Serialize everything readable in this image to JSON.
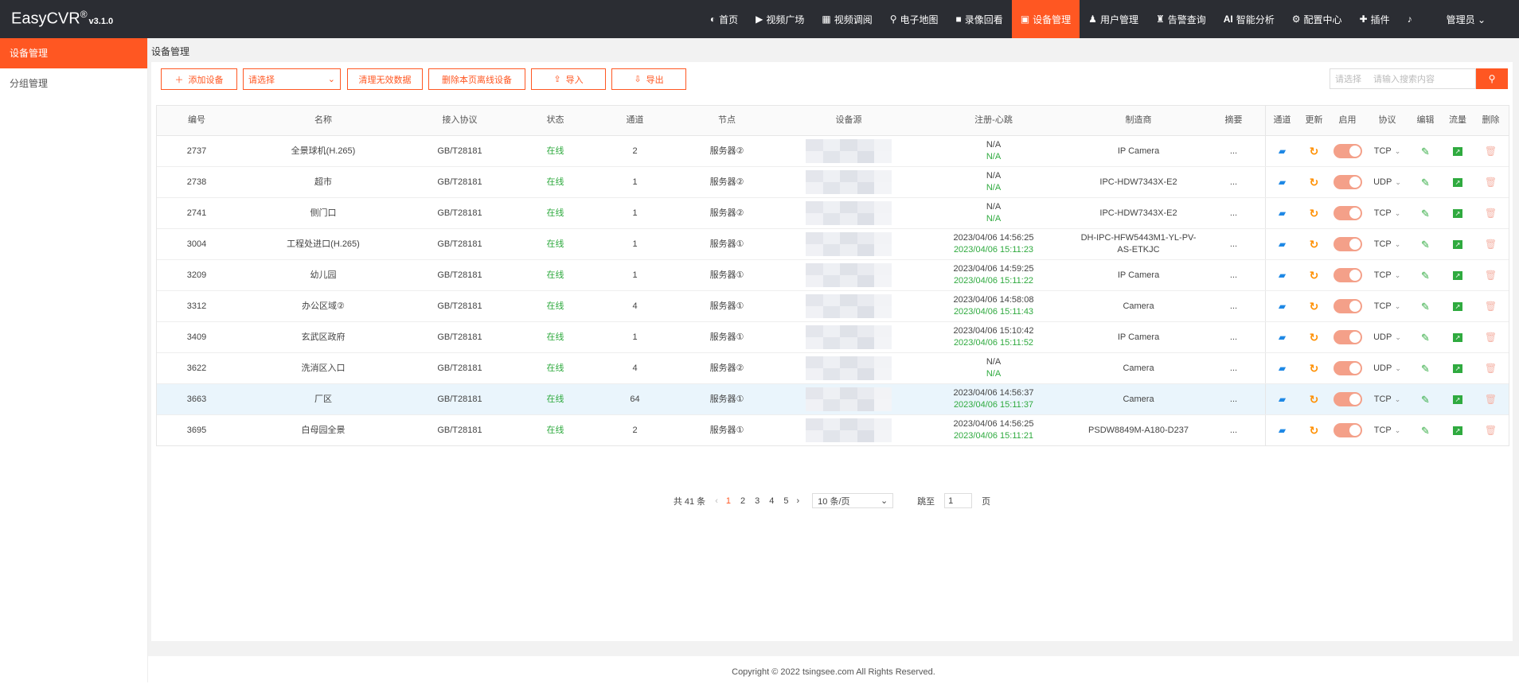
{
  "app": {
    "name": "EasyCVR",
    "reg_mark": "®",
    "version": "v3.1.0"
  },
  "nav": [
    {
      "icon": "dashboard-icon",
      "glyph": "◐",
      "label": "首页"
    },
    {
      "icon": "play-circle-icon",
      "glyph": "▶",
      "label": "视频广场"
    },
    {
      "icon": "grid-icon",
      "glyph": "▦",
      "label": "视频调阅"
    },
    {
      "icon": "map-pin-icon",
      "glyph": "⚲",
      "label": "电子地图"
    },
    {
      "icon": "video-camera-icon",
      "glyph": "■",
      "label": "录像回看"
    },
    {
      "icon": "device-icon",
      "glyph": "▣",
      "label": "设备管理"
    },
    {
      "icon": "user-icon",
      "glyph": "♟",
      "label": "用户管理"
    },
    {
      "icon": "alarm-icon",
      "glyph": "♜",
      "label": "告警查询"
    },
    {
      "icon": "ai-icon",
      "glyph": "AI",
      "label": "智能分析"
    },
    {
      "icon": "gear-icon",
      "glyph": "⚙",
      "label": "配置中心"
    },
    {
      "icon": "puzzle-icon",
      "glyph": "✚",
      "label": "插件"
    },
    {
      "icon": "bell-icon",
      "glyph": "♪",
      "label": ""
    },
    {
      "icon": "admin-icon",
      "glyph": "",
      "label": "管理员 ⌄"
    }
  ],
  "sidebar": {
    "items": [
      {
        "label": "设备管理"
      },
      {
        "label": "分组管理"
      }
    ]
  },
  "breadcrumb": "设备管理",
  "toolbar": {
    "add_label": "添加设备",
    "select_placeholder": "请选择",
    "clean_label": "清理无效数据",
    "delete_offline_label": "删除本页离线设备",
    "import_label": "导入",
    "export_label": "导出"
  },
  "search": {
    "select_placeholder": "请选择",
    "input_placeholder": "请输入搜索内容"
  },
  "table": {
    "headers": [
      "编号",
      "名称",
      "接入协议",
      "状态",
      "通道",
      "节点",
      "设备源",
      "注册-心跳",
      "制造商",
      "摘要",
      "通道",
      "更新",
      "启用",
      "协议",
      "编辑",
      "流量",
      "删除"
    ],
    "rows": [
      {
        "id": "2737",
        "name": "全景球机(H.265)",
        "protocol": "GB/T28181",
        "status": "在线",
        "channels": "2",
        "node": "服务器②",
        "reg": "N/A",
        "heartbeat": "N/A",
        "manufacturer": "IP Camera",
        "summary": "...",
        "transport": "TCP"
      },
      {
        "id": "2738",
        "name": "超市",
        "protocol": "GB/T28181",
        "status": "在线",
        "channels": "1",
        "node": "服务器②",
        "reg": "N/A",
        "heartbeat": "N/A",
        "manufacturer": "IPC-HDW7343X-E2",
        "summary": "...",
        "transport": "UDP"
      },
      {
        "id": "2741",
        "name": "侧门口",
        "protocol": "GB/T28181",
        "status": "在线",
        "channels": "1",
        "node": "服务器②",
        "reg": "N/A",
        "heartbeat": "N/A",
        "manufacturer": "IPC-HDW7343X-E2",
        "summary": "...",
        "transport": "TCP"
      },
      {
        "id": "3004",
        "name": "工程处进口(H.265)",
        "protocol": "GB/T28181",
        "status": "在线",
        "channels": "1",
        "node": "服务器①",
        "reg": "2023/04/06 14:56:25",
        "heartbeat": "2023/04/06 15:11:23",
        "manufacturer": "DH-IPC-HFW5443M1-YL-PV-AS-ETKJC",
        "summary": "...",
        "transport": "TCP"
      },
      {
        "id": "3209",
        "name": "幼儿园",
        "protocol": "GB/T28181",
        "status": "在线",
        "channels": "1",
        "node": "服务器①",
        "reg": "2023/04/06 14:59:25",
        "heartbeat": "2023/04/06 15:11:22",
        "manufacturer": "IP Camera",
        "summary": "...",
        "transport": "TCP"
      },
      {
        "id": "3312",
        "name": "办公区域②",
        "protocol": "GB/T28181",
        "status": "在线",
        "channels": "4",
        "node": "服务器①",
        "reg": "2023/04/06 14:58:08",
        "heartbeat": "2023/04/06 15:11:43",
        "manufacturer": "Camera",
        "summary": "...",
        "transport": "TCP"
      },
      {
        "id": "3409",
        "name": "玄武区政府",
        "protocol": "GB/T28181",
        "status": "在线",
        "channels": "1",
        "node": "服务器①",
        "reg": "2023/04/06 15:10:42",
        "heartbeat": "2023/04/06 15:11:52",
        "manufacturer": "IP Camera",
        "summary": "...",
        "transport": "UDP"
      },
      {
        "id": "3622",
        "name": "洗消区入口",
        "protocol": "GB/T28181",
        "status": "在线",
        "channels": "4",
        "node": "服务器②",
        "reg": "N/A",
        "heartbeat": "N/A",
        "manufacturer": "Camera",
        "summary": "...",
        "transport": "UDP"
      },
      {
        "id": "3663",
        "name": "厂区",
        "protocol": "GB/T28181",
        "status": "在线",
        "channels": "64",
        "node": "服务器①",
        "reg": "2023/04/06 14:56:37",
        "heartbeat": "2023/04/06 15:11:37",
        "manufacturer": "Camera",
        "summary": "...",
        "transport": "TCP"
      },
      {
        "id": "3695",
        "name": "白母园全景",
        "protocol": "GB/T28181",
        "status": "在线",
        "channels": "2",
        "node": "服务器①",
        "reg": "2023/04/06 14:56:25",
        "heartbeat": "2023/04/06 15:11:21",
        "manufacturer": "PSDW8849M-A180-D237",
        "summary": "...",
        "transport": "TCP"
      }
    ],
    "highlighted_row": 8
  },
  "pager": {
    "total": "共 41 条",
    "pages": [
      "1",
      "2",
      "3",
      "4",
      "5"
    ],
    "current_page": "1",
    "prev": "‹",
    "next": "›",
    "page_size": "10 条/页",
    "jump_prefix": "跳至",
    "jump_value": "1",
    "jump_suffix": "页"
  },
  "footer": "Copyright © 2022 tsingsee.com All Rights Reserved.",
  "colors": {
    "accent": "#ff5722",
    "topbar": "#2b2d33",
    "online": "#2faa3f"
  }
}
